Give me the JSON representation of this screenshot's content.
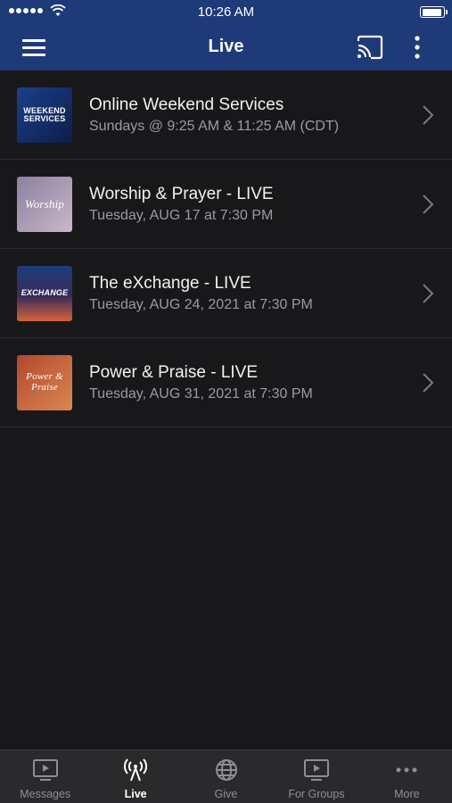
{
  "status_bar": {
    "time": "10:26 AM"
  },
  "nav": {
    "title": "Live",
    "menu_icon": "hamburger-menu-icon",
    "cast_icon": "cast-icon",
    "more_icon": "vertical-dots-icon"
  },
  "items": [
    {
      "title": "Online Weekend Services",
      "subtitle": "Sundays @ 9:25 AM & 11:25 AM (CDT)",
      "thumb_text": "WEEKEND SERVICES",
      "thumb_colors": [
        "#1a3f8a",
        "#0d1f4a"
      ]
    },
    {
      "title": "Worship & Prayer - LIVE",
      "subtitle": "Tuesday, AUG 17 at 7:30 PM",
      "thumb_text": "Worship",
      "thumb_colors": [
        "#8d7fa0",
        "#b7a9c0"
      ]
    },
    {
      "title": "The eXchange - LIVE",
      "subtitle": "Tuesday, AUG 24, 2021 at 7:30 PM",
      "thumb_text": "EXCHANGE",
      "thumb_colors": [
        "#1b3e7a",
        "#d2643a"
      ]
    },
    {
      "title": "Power & Praise - LIVE",
      "subtitle": "Tuesday, AUG 31, 2021 at 7:30 PM",
      "thumb_text": "Power & Praise",
      "thumb_colors": [
        "#b3472e",
        "#d98850"
      ]
    }
  ],
  "tabs": [
    {
      "label": "Messages",
      "icon": "play-screen-icon",
      "active": false
    },
    {
      "label": "Live",
      "icon": "broadcast-antenna-icon",
      "active": true
    },
    {
      "label": "Give",
      "icon": "globe-icon",
      "active": false
    },
    {
      "label": "For Groups",
      "icon": "play-screen-icon",
      "active": false
    },
    {
      "label": "More",
      "icon": "horizontal-dots-icon",
      "active": false
    }
  ],
  "colors": {
    "nav_background": "#1e3a78",
    "list_background": "#18181a",
    "tab_bar_background": "#2a2a2d"
  }
}
